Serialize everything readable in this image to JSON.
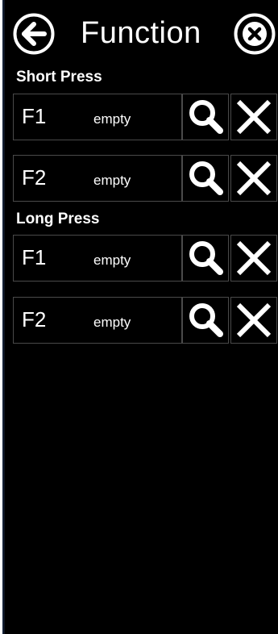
{
  "header": {
    "title": "Function",
    "back_icon": "arrow-left-circle-icon",
    "close_icon": "close-circle-icon"
  },
  "sections": [
    {
      "label": "Short Press",
      "rows": [
        {
          "key": "F1",
          "value": "empty"
        },
        {
          "key": "F2",
          "value": "empty"
        }
      ]
    },
    {
      "label": "Long Press",
      "rows": [
        {
          "key": "F1",
          "value": "empty"
        },
        {
          "key": "F2",
          "value": "empty"
        }
      ]
    }
  ],
  "colors": {
    "background": "#000000",
    "text": "#ffffff",
    "border": "#4a4a4a"
  }
}
